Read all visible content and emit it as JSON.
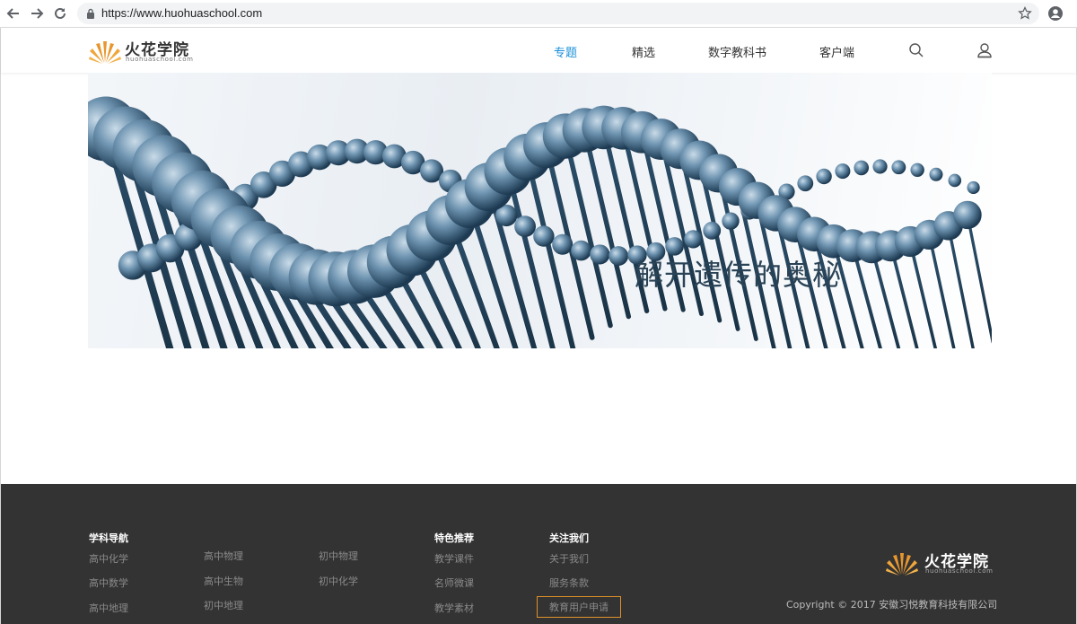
{
  "browser": {
    "url": "https://www.huohuaschool.com"
  },
  "header": {
    "logo_name": "火花学院",
    "logo_domain": "huohuaschool.com",
    "nav": [
      "专题",
      "精选",
      "数字教科书",
      "客户端"
    ],
    "active_nav": "专题"
  },
  "banner": {
    "title": "解开遗传的奥秘"
  },
  "footer": {
    "subject_nav": {
      "heading": "学科导航",
      "col1": [
        "高中化学",
        "高中数学",
        "高中地理"
      ],
      "col2": [
        "高中物理",
        "高中生物",
        "初中地理"
      ],
      "col3": [
        "初中物理",
        "初中化学"
      ]
    },
    "featured": {
      "heading": "特色推荐",
      "links": [
        "教学课件",
        "名师微课",
        "教学素材"
      ]
    },
    "follow": {
      "heading": "关注我们",
      "links": [
        "关于我们",
        "服务条款",
        "教育用户申请"
      ]
    },
    "logo_name": "火花学院",
    "logo_domain": "huohuaschool.com",
    "copyright": "Copyright © 2017 安徽习悦教育科技有限公司"
  },
  "colors": {
    "accent": "#1a8fd8",
    "brand_orange": "#e0912a",
    "footer_bg": "#333333"
  }
}
